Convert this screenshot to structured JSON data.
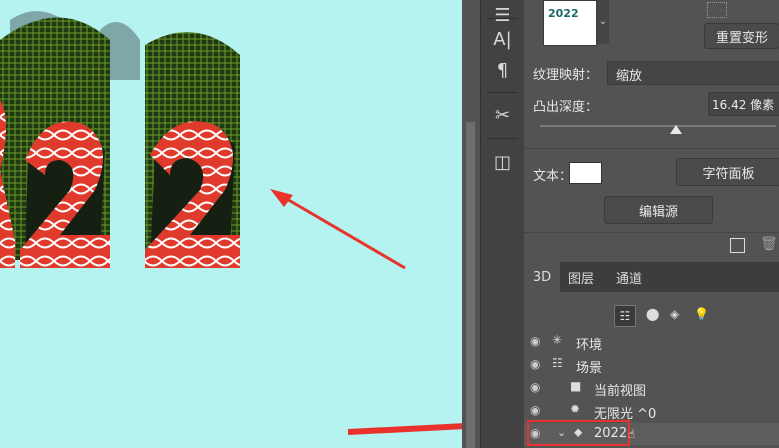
{
  "canvas": {
    "text_3d": "2022",
    "bg_color": "#b4f3f0"
  },
  "toolstrip": {
    "tools": [
      {
        "name": "menu-icon",
        "glyph": "☰"
      },
      {
        "name": "character-icon",
        "glyph": "A|"
      },
      {
        "name": "paragraph-icon",
        "glyph": "¶"
      },
      {
        "name": "scissors-icon",
        "glyph": "✂"
      },
      {
        "name": "layer-comp-icon",
        "glyph": "◫"
      }
    ]
  },
  "properties": {
    "preview_text": "2022",
    "reset_button": "重置变形",
    "texture_label": "纹理映射：",
    "texture_value": "缩放",
    "depth_label": "凸出深度：",
    "depth_value": "16.42 像素",
    "depth_slider": 0.4,
    "text_label": "文本：",
    "text_color": "#ffffff",
    "char_panel_button": "字符面板",
    "edit_source_button": "编辑源"
  },
  "tabs": [
    {
      "label": "3D",
      "active": true
    },
    {
      "label": "图层",
      "active": false
    },
    {
      "label": "通道",
      "active": false
    }
  ],
  "tree": {
    "items": [
      {
        "label": "环境",
        "icon": "environment-icon"
      },
      {
        "label": "场景",
        "icon": "scene-icon"
      },
      {
        "label": "当前视图",
        "icon": "camera-icon"
      },
      {
        "label": "无限光 ^0",
        "icon": "light-icon"
      },
      {
        "label": "2022",
        "icon": "mesh-icon",
        "selected": true
      }
    ]
  }
}
